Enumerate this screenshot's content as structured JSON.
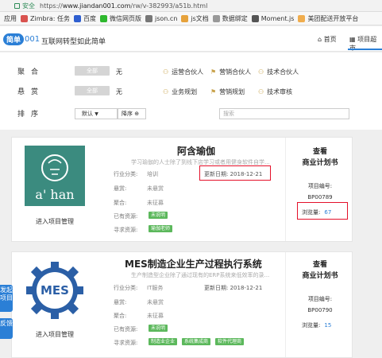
{
  "browser": {
    "secure_label": "安全",
    "url_prefix": "https://",
    "url_host": "www.jiandan001.com",
    "url_path": "/rw/v-382993/a51b.html"
  },
  "bookmarks": [
    {
      "label": "应用",
      "color": "#4a78c2"
    },
    {
      "label": "Zimbra: 任务",
      "color": "#d9534f"
    },
    {
      "label": "百度",
      "color": "#2f5fd0"
    },
    {
      "label": "微信网页版",
      "color": "#2eb82e"
    },
    {
      "label": "json.cn",
      "color": "#777777"
    },
    {
      "label": "js文档",
      "color": "#e6a23c"
    },
    {
      "label": "数据绑定",
      "color": "#999999"
    },
    {
      "label": "Moment.js",
      "color": "#555555"
    },
    {
      "label": "美团配送开放平台",
      "color": "#f0ad4e"
    }
  ],
  "header": {
    "logo_bubble": "简单",
    "logo_digits": "001",
    "slogan": "互联网转型如此简单",
    "nav_home": "首页",
    "nav_home_icon": "house-icon",
    "nav_projects": "项目超市",
    "nav_projects_icon": "grid-icon"
  },
  "filters": {
    "row1": {
      "label": "聚合",
      "all": "全部",
      "none": "无",
      "links": [
        "运营合伙人",
        "营销合伙人",
        "技术合伙人"
      ]
    },
    "row2": {
      "label": "悬赏",
      "all": "全部",
      "none": "无",
      "links": [
        "业务规划",
        "营销规划",
        "技术审核"
      ]
    },
    "sort": {
      "label": "排序",
      "default": "默认",
      "order": "降序",
      "search_placeholder": "搜索"
    }
  },
  "projects": [
    {
      "title": "阿含瑜伽",
      "desc": "学习瑜伽的人士除了到线下店学习或者用健身软件自学...",
      "logo_text": "a' han",
      "industry_label": "行业分类:",
      "industry": "培训",
      "update_label": "更新日期:",
      "update": "2018-12-21",
      "reward_label": "悬赏:",
      "reward": "未悬赏",
      "gather_label": "聚合:",
      "gather": "未征募",
      "resources_label": "已有资源:",
      "resources": [
        "未说明"
      ],
      "seeking_label": "寻求资源:",
      "seeking": [
        "瑜伽老师"
      ],
      "manage": "进入项目管理",
      "view": "查看",
      "bp": "商业计划书",
      "number_label": "项目编号:",
      "number": "BP00789",
      "views_label": "浏览量:",
      "views": "67"
    },
    {
      "title": "MES制造企业生产过程执行系统",
      "desc": "生产制造型企业除了通过现有的ERP系统来低效率的录...",
      "logo_text": "MES",
      "industry_label": "行业分类:",
      "industry": "IT服务",
      "update_label": "更新日期:",
      "update": "2018-12-21",
      "reward_label": "悬赏:",
      "reward": "未悬赏",
      "gather_label": "聚合:",
      "gather": "未征募",
      "resources_label": "已有资源:",
      "resources": [
        "未说明"
      ],
      "seeking_label": "寻求资源:",
      "seeking": [
        "制造业企业",
        "系统集成商",
        "软件代理商"
      ],
      "manage": "进入项目管理",
      "view": "查看",
      "bp": "商业计划书",
      "number_label": "项目编号:",
      "number": "BP00790",
      "views_label": "浏览量:",
      "views": "15"
    }
  ],
  "floating": {
    "btn1": "发起项目",
    "btn2": "反馈"
  },
  "colors": {
    "brand": "#2b7fd6",
    "tag_green": "#5cb85c",
    "highlight_red": "#e4102a",
    "yoga_teal": "#3b8b7f",
    "mes_blue": "#2b5fa6"
  }
}
